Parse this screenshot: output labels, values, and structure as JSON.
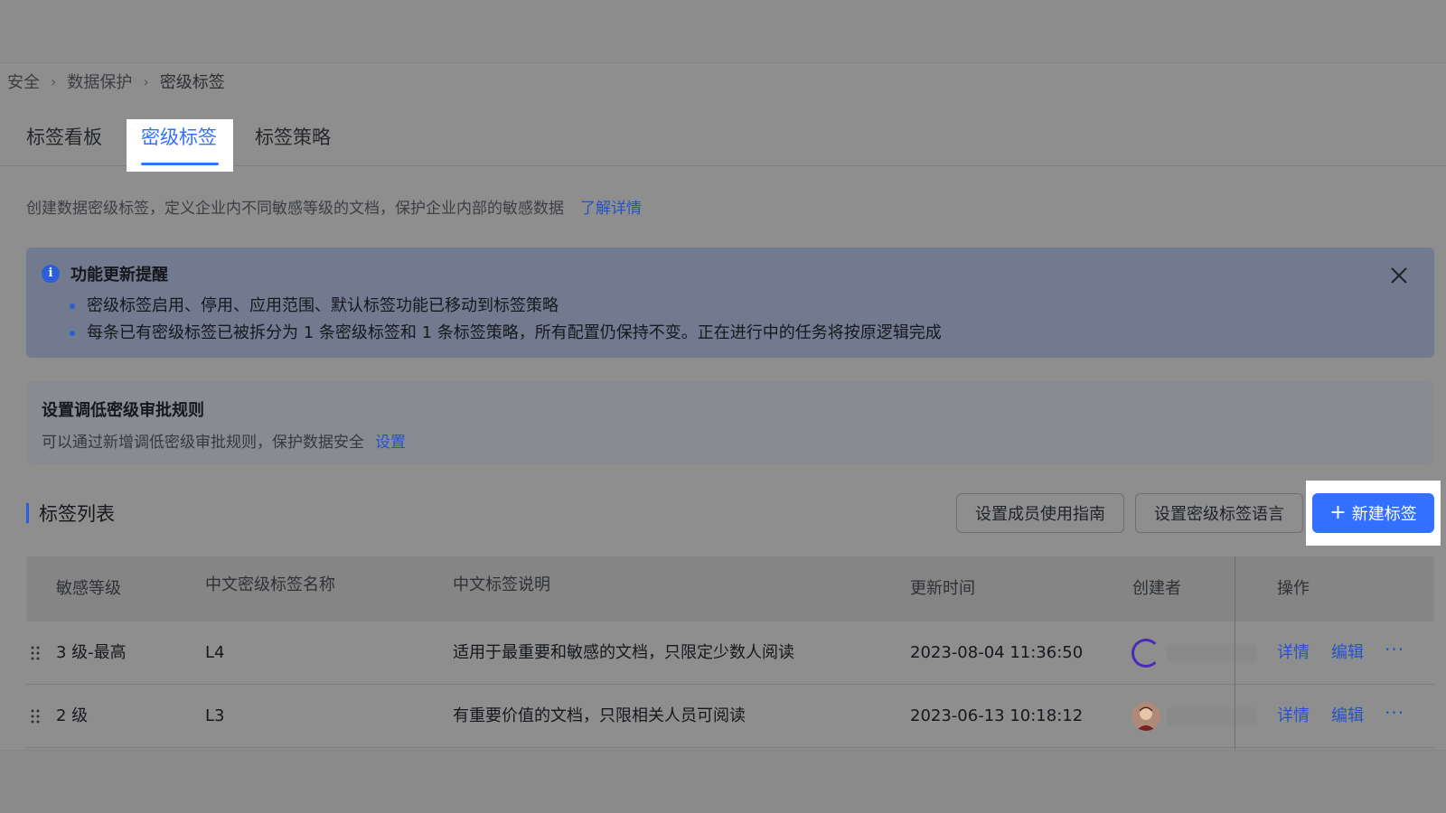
{
  "breadcrumb": {
    "items": [
      "安全",
      "数据保护",
      "密级标签"
    ]
  },
  "tabs": [
    {
      "label": "标签看板",
      "active": false
    },
    {
      "label": "密级标签",
      "active": true
    },
    {
      "label": "标签策略",
      "active": false
    }
  ],
  "description": {
    "text": "创建数据密级标签，定义企业内不同敏感等级的文档，保护企业内部的敏感数据",
    "link": "了解详情"
  },
  "notice": {
    "title": "功能更新提醒",
    "items": [
      "密级标签启用、停用、应用范围、默认标签功能已移动到标签策略",
      "每条已有密级标签已被拆分为 1 条密级标签和 1 条标签策略，所有配置仍保持不变。正在进行中的任务将按原逻辑完成"
    ]
  },
  "rule_card": {
    "title": "设置调低密级审批规则",
    "subtitle": "可以通过新增调低密级审批规则，保护数据安全",
    "link": "设置"
  },
  "list": {
    "title": "标签列表",
    "buttons": {
      "guide": "设置成员使用指南",
      "language": "设置密级标签语言",
      "new": "新建标签"
    },
    "columns": [
      "敏感等级",
      "中文密级标签名称",
      "中文标签说明",
      "更新时间",
      "创建者",
      "操作"
    ],
    "rows": [
      {
        "level": "3 级-最高",
        "name": "L4",
        "desc": "适用于最重要和敏感的文档，只限定少数人阅读",
        "updated": "2023-08-04 11:36:50",
        "detail": "详情",
        "edit": "编辑",
        "more": "···"
      },
      {
        "level": "2 级",
        "name": "L3",
        "desc": "有重要价值的文档，只限相关人员可阅读",
        "updated": "2023-06-13 10:18:12",
        "detail": "详情",
        "edit": "编辑",
        "more": "···"
      }
    ]
  },
  "colors": {
    "accent": "#3370ff",
    "link": "#2553c7"
  }
}
